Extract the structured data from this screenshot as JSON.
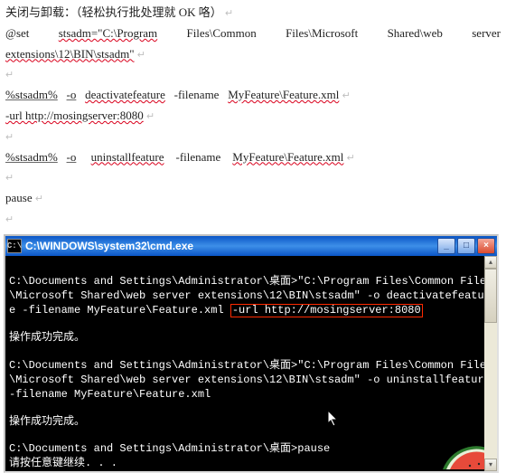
{
  "doc": {
    "heading": "关闭与卸载：（轻松执行批处理就 OK 咯）",
    "l1a": "@set",
    "l1b": "stsadm=\"C:\\Program",
    "l1c": "Files\\Common",
    "l1d": "Files\\Microsoft",
    "l1e": "Shared\\web",
    "l1f": "server",
    "l2": "extensions\\12\\BIN\\stsadm\"",
    "l3a": "%stsadm%",
    "l3b": "-o",
    "l3c": "deactivatefeature",
    "l3d": "-filename",
    "l3e": "MyFeature\\Feature.xml",
    "l4": " -url http://mosingserver:8080",
    "l5a": "%stsadm%",
    "l5b": "-o",
    "l5c": "uninstallfeature",
    "l5d": "-filename",
    "l5e": "MyFeature\\Feature.xml",
    "l6": "pause",
    "para": "↵"
  },
  "console": {
    "icon": "C:\\",
    "title": " C:\\WINDOWS\\system32\\cmd.exe",
    "btn_min": "_",
    "btn_max": "□",
    "btn_close": "×",
    "line1": "C:\\Documents and Settings\\Administrator\\桌面>\"C:\\Program Files\\Common Files\\Microsoft Shared\\web server extensions\\12\\BIN\\stsadm\" -o deactivatefeature -filename MyFeature\\Feature.xml ",
    "line1_boxed": "-url http://mosingserver:8080",
    "ok1": "操作成功完成。",
    "line2": "C:\\Documents and Settings\\Administrator\\桌面>\"C:\\Program Files\\Common Files\\Microsoft Shared\\web server extensions\\12\\BIN\\stsadm\" -o uninstallfeature -filename MyFeature\\Feature.xml",
    "ok2": "操作成功完成。",
    "line3": "C:\\Documents and Settings\\Administrator\\桌面>pause",
    "line4": "请按任意键继续. . ."
  }
}
